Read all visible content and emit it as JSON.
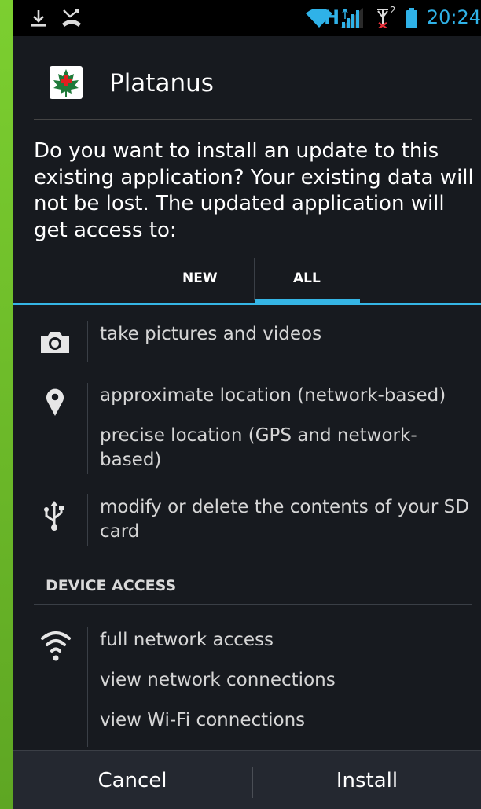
{
  "status": {
    "time": "20:24",
    "network_type": "H",
    "sim2": "2"
  },
  "app": {
    "name": "Platanus",
    "icon": "maple-leaf-icon"
  },
  "prompt": "Do you want to install an update to this existing application? Your existing data will not be lost. The updated application will get access to:",
  "tabs": [
    {
      "label": "NEW",
      "selected": false
    },
    {
      "label": "ALL",
      "selected": true
    }
  ],
  "permissions": {
    "camera": [
      "take pictures and videos"
    ],
    "location": [
      "approximate location (network-based)",
      "precise location (GPS and network-",
      "based)"
    ],
    "storage": [
      "modify or delete the contents of your SD",
      "card"
    ]
  },
  "device_access": {
    "heading": "DEVICE ACCESS",
    "network": [
      "full network access",
      "view network connections",
      "view Wi-Fi connections"
    ]
  },
  "buttons": {
    "cancel": "Cancel",
    "install": "Install"
  },
  "colors": {
    "accent": "#35b5e5",
    "background": "#171a1f"
  }
}
